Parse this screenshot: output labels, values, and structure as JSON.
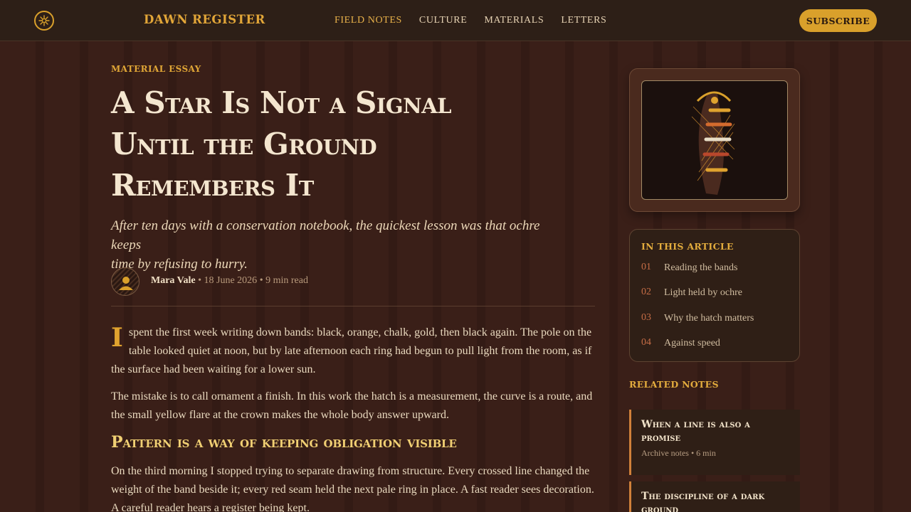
{
  "header": {
    "brand": "DAWN REGISTER",
    "logo_icon": "sun-star-icon",
    "nav": [
      {
        "label": "FIELD NOTES",
        "active": true
      },
      {
        "label": "CULTURE",
        "active": false
      },
      {
        "label": "MATERIALS",
        "active": false
      },
      {
        "label": "LETTERS",
        "active": false
      }
    ],
    "subscribe_label": "SUBSCRIBE"
  },
  "article": {
    "kicker": "MATERIAL ESSAY",
    "title_lines": [
      "A Star Is Not a Signal",
      "Until the Ground",
      "Remembers It"
    ],
    "dek_lines": [
      "After ten days with a conservation notebook, the quickest lesson was that ochre keeps",
      "time by refusing to hurry."
    ],
    "author": "Mara Vale",
    "date": "18 June 2026",
    "read_time": "9 min read",
    "meta_separator": " • ",
    "dropcap": "I",
    "paragraph1": " spent the first week writing down bands: black, orange, chalk, gold, then black again. The pole on the table looked quiet at noon, but by late afternoon each ring had begun to pull light from the room, as if the surface had been waiting for a lower sun.",
    "paragraph2": "The mistake is to call ornament a finish. In this work the hatch is a measurement, the curve is a route, and the small yellow flare at the crown makes the whole body answer upward.",
    "subheading": "Pattern is a way of keeping obligation visible",
    "paragraph3": "On the third morning I stopped trying to separate drawing from structure. Every crossed line changed the weight of the band beside it; every red seam held the next pale ring in place. A fast reader sees decoration. A careful reader hears a register being kept."
  },
  "sidebar": {
    "toc_title": "IN THIS ARTICLE",
    "toc": [
      {
        "num": "01",
        "label": "Reading the bands"
      },
      {
        "num": "02",
        "label": "Light held by ochre"
      },
      {
        "num": "03",
        "label": "Why the hatch matters"
      },
      {
        "num": "04",
        "label": "Against speed"
      }
    ],
    "related_title": "RELATED NOTES",
    "related": [
      {
        "title": "When a line is also a promise",
        "meta": "Archive notes • 6 min"
      },
      {
        "title": "The discipline of a dark ground",
        "meta": ""
      }
    ]
  },
  "colors": {
    "accent": "#d9a02b",
    "background": "#3a1f18",
    "header_bg": "#2d1f17",
    "toc_number": "#c66d46"
  }
}
